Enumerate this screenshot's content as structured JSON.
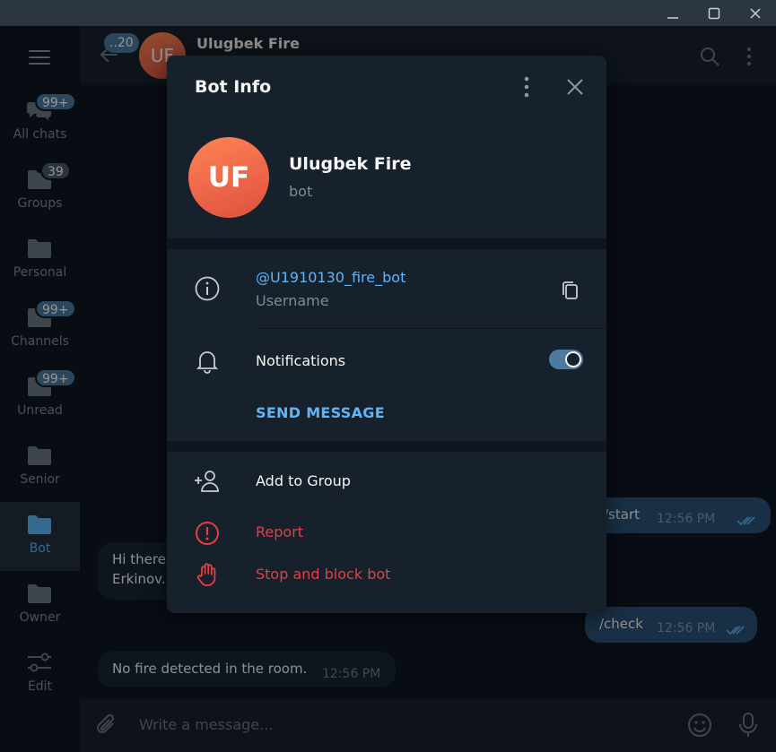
{
  "window": {
    "minimize_icon": "minimize-icon",
    "maximize_icon": "maximize-icon",
    "close_icon": "close-icon"
  },
  "sidebar": {
    "items": [
      {
        "label": "All chats",
        "badge": "99+",
        "icon": "chats-icon"
      },
      {
        "label": "Groups",
        "badge": "39",
        "icon": "folder-icon"
      },
      {
        "label": "Personal",
        "badge": "",
        "icon": "folder-icon"
      },
      {
        "label": "Channels",
        "badge": "99+",
        "icon": "folder-icon"
      },
      {
        "label": "Unread",
        "badge": "99+",
        "icon": "folder-icon"
      },
      {
        "label": "Senior",
        "badge": "",
        "icon": "folder-icon"
      },
      {
        "label": "Bot",
        "badge": "",
        "icon": "folder-icon",
        "active": true
      },
      {
        "label": "Owner",
        "badge": "",
        "icon": "folder-icon"
      },
      {
        "label": "Edit",
        "badge": "",
        "icon": "sliders-icon"
      }
    ]
  },
  "chat_header": {
    "back_badge": "..20",
    "avatar_initials": "UF",
    "title": "Ulugbek Fire"
  },
  "messages": [
    {
      "direction": "out",
      "text": "/start",
      "time": "12:56 PM"
    },
    {
      "direction": "in",
      "text_line1": "Hi there",
      "text_line2": "Erkinov."
    },
    {
      "direction": "out",
      "text": "/check",
      "time": "12:56 PM"
    },
    {
      "direction": "in",
      "text": "No fire detected in the room.",
      "time": "12:56 PM"
    }
  ],
  "input": {
    "placeholder": "Write a message..."
  },
  "modal": {
    "title": "Bot Info",
    "avatar_initials": "UF",
    "name": "Ulugbek Fire",
    "status": "bot",
    "username": "@U1910130_fire_bot",
    "username_label": "Username",
    "notifications_label": "Notifications",
    "notifications_on": true,
    "send_message": "SEND MESSAGE",
    "add_to_group": "Add to Group",
    "report": "Report",
    "stop_block": "Stop and block bot"
  },
  "colors": {
    "accent": "#5eb5f7",
    "danger": "#e53e43",
    "badge": "#4b7ba1",
    "outgoing_bubble": "#2b5278"
  }
}
